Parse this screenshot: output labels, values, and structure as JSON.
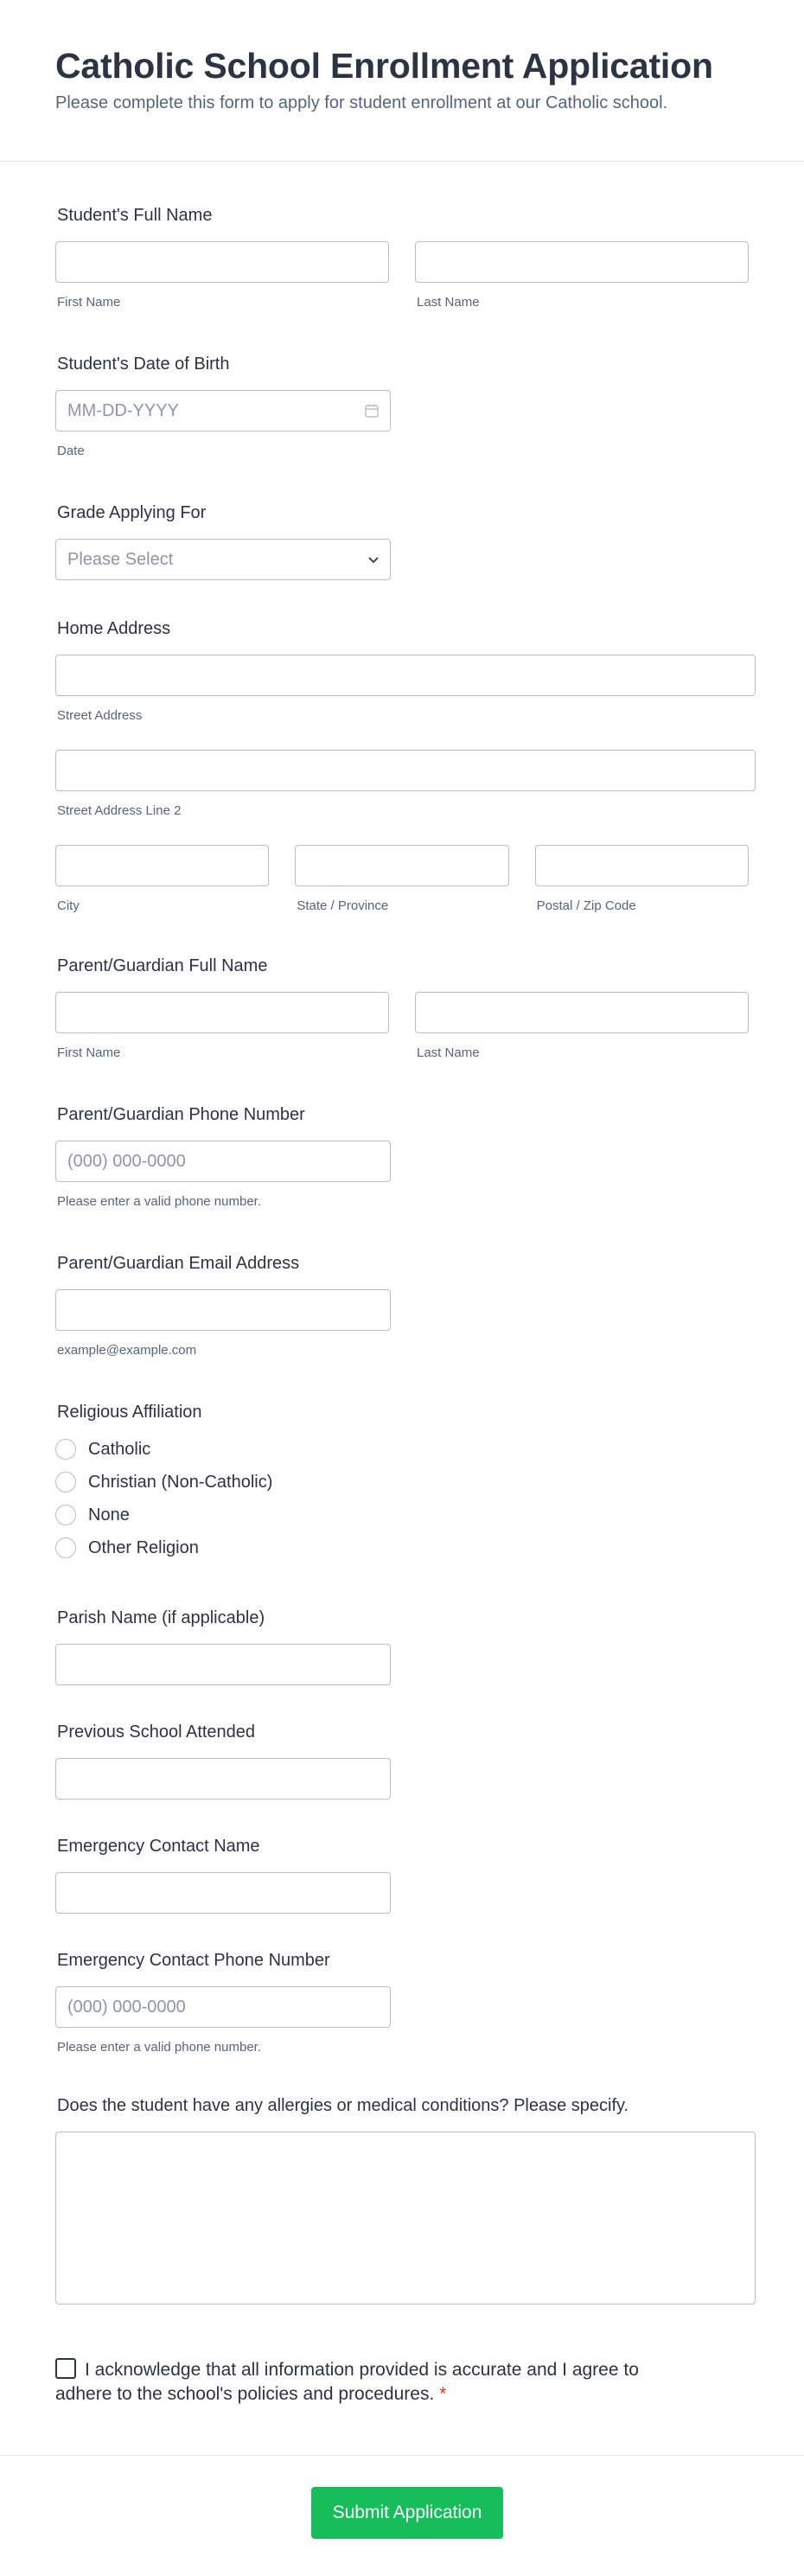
{
  "header": {
    "title": "Catholic School Enrollment Application",
    "subtitle": "Please complete this form to apply for student enrollment at our Catholic school."
  },
  "student_name": {
    "label": "Student's Full Name",
    "first_sub": "First Name",
    "last_sub": "Last Name"
  },
  "dob": {
    "label": "Student's Date of Birth",
    "placeholder": "MM-DD-YYYY",
    "sub": "Date",
    "icon": "calendar-icon"
  },
  "grade": {
    "label": "Grade Applying For",
    "selected": "Please Select",
    "icon": "chevron-down-icon"
  },
  "address": {
    "label": "Home Address",
    "street_sub": "Street Address",
    "street2_sub": "Street Address Line 2",
    "city_sub": "City",
    "state_sub": "State / Province",
    "zip_sub": "Postal / Zip Code"
  },
  "guardian_name": {
    "label": "Parent/Guardian Full Name",
    "first_sub": "First Name",
    "last_sub": "Last Name"
  },
  "guardian_phone": {
    "label": "Parent/Guardian Phone Number",
    "placeholder": "(000) 000-0000",
    "sub": "Please enter a valid phone number."
  },
  "guardian_email": {
    "label": "Parent/Guardian Email Address",
    "sub": "example@example.com"
  },
  "religion": {
    "label": "Religious Affiliation",
    "options": [
      "Catholic",
      "Christian (Non-Catholic)",
      "None",
      "Other Religion"
    ]
  },
  "parish": {
    "label": "Parish Name (if applicable)"
  },
  "prev_school": {
    "label": "Previous School Attended"
  },
  "emergency_name": {
    "label": "Emergency Contact Name"
  },
  "emergency_phone": {
    "label": "Emergency Contact Phone Number",
    "placeholder": "(000) 000-0000",
    "sub": "Please enter a valid phone number."
  },
  "medical": {
    "label": "Does the student have any allergies or medical conditions? Please specify."
  },
  "acknowledge": {
    "text": "I acknowledge that all information provided is accurate and I agree to adhere to the school's policies and procedures.",
    "required_mark": "*"
  },
  "submit": {
    "label": "Submit Application",
    "color": "#18bd5b"
  }
}
